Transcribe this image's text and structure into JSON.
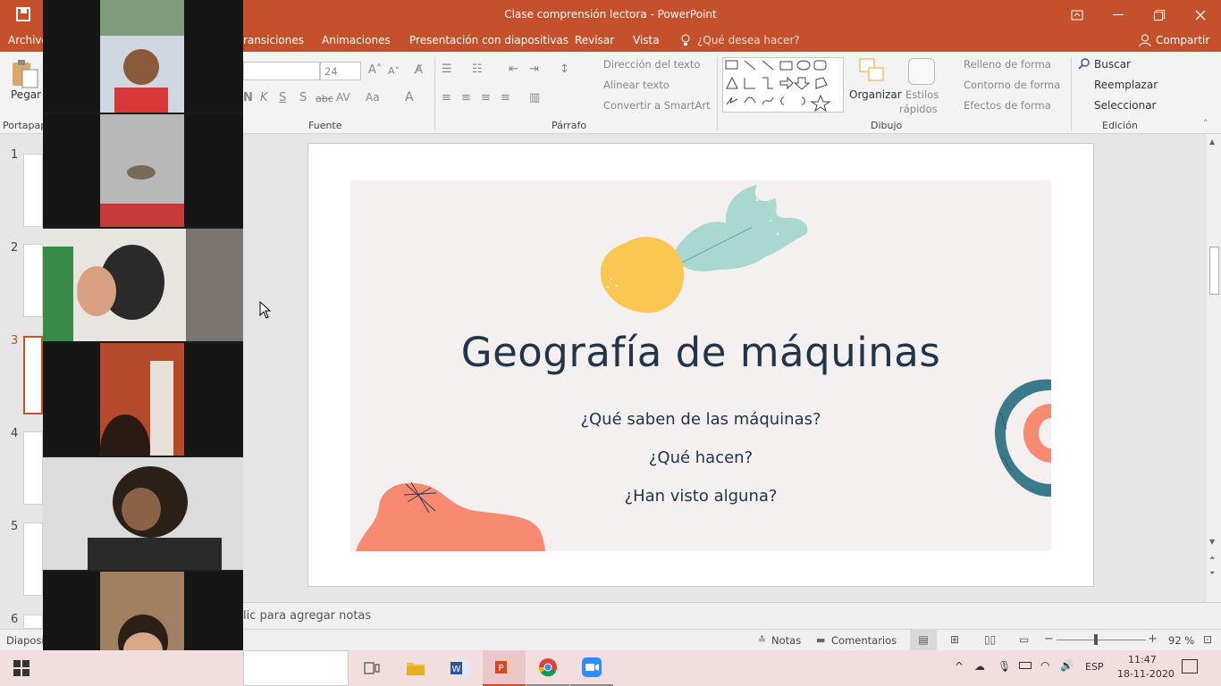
{
  "window": {
    "title": "Clase comprensión lectora - PowerPoint"
  },
  "tabs": [
    "Archivo",
    "ransiciones",
    "Animaciones",
    "Presentación con diapositivas",
    "Revisar",
    "Vista"
  ],
  "tell_me": "¿Qué desea hacer?",
  "share": "Compartir",
  "ribbon": {
    "paste": "Pegar",
    "clipboard_group": "Portapap",
    "font_group": "Fuente",
    "font_size": "24",
    "paragraph_group": "Párrafo",
    "text_direction": "Dirección del texto",
    "align_text": "Alinear texto",
    "smartart": "Convertir a SmartArt",
    "organize": "Organizar",
    "quick_styles_1": "Estilos",
    "quick_styles_2": "rápidos",
    "shape_fill": "Relleno de forma",
    "shape_outline": "Contorno de forma",
    "shape_effects": "Efectos de forma",
    "drawing_group": "Dibujo",
    "find": "Buscar",
    "replace": "Reemplazar",
    "select": "Seleccionar",
    "editing_group": "Edición"
  },
  "thumbnails": [
    "1",
    "2",
    "3",
    "4",
    "5",
    "6"
  ],
  "slide": {
    "title": "Geografía de máquinas",
    "questions": [
      "¿Qué saben de las máquinas?",
      "¿Qué hacen?",
      "¿Han visto alguna?"
    ]
  },
  "notes_placeholder": "lic para agregar notas",
  "status": {
    "slide": "Diaposit",
    "notes": "Notas",
    "comments": "Comentarios",
    "zoom": "92 %"
  },
  "taskbar": {
    "language": "ESP",
    "time": "11:47",
    "date": "18-11-2020"
  },
  "colors": {
    "accent": "#c5502c",
    "slide_bg": "#f5f0f0",
    "title_text": "#21354a",
    "coral": "#f88a72",
    "yellow": "#fbc753",
    "mint": "#a8d8d0",
    "teal": "#3a7a8a"
  }
}
